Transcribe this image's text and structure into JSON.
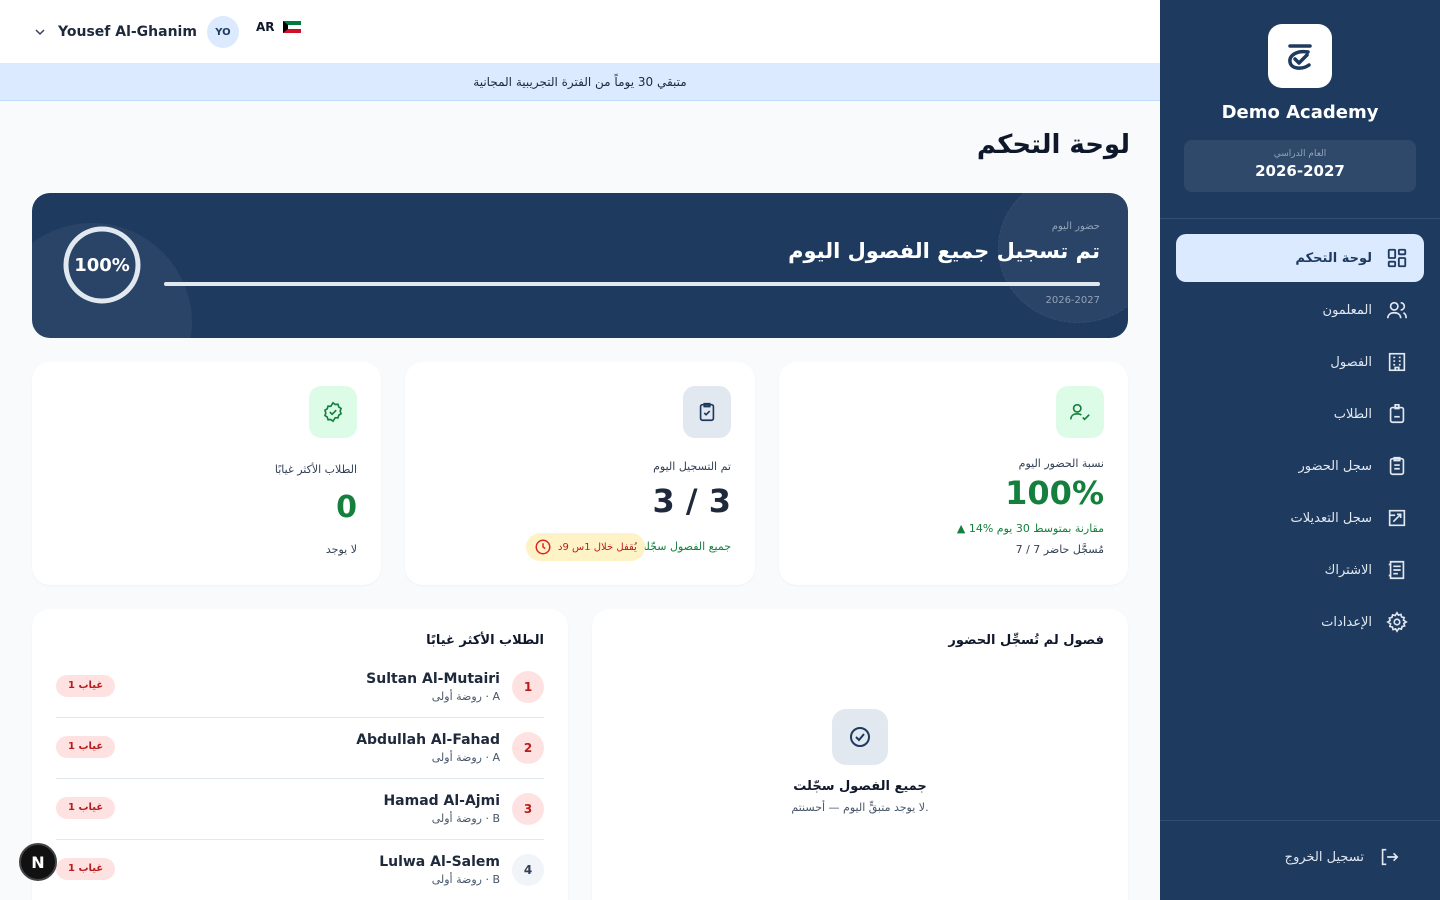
{
  "sidebar": {
    "org_name": "Demo Academy",
    "year_label": "العام الدراسي",
    "year_value": "2026-2027",
    "nav": [
      {
        "label": "لوحة التحكم",
        "icon": "dashboard-icon",
        "active": true
      },
      {
        "label": "المعلمون",
        "icon": "users-icon"
      },
      {
        "label": "الفصول",
        "icon": "building-icon"
      },
      {
        "label": "الطلاب",
        "icon": "badge-icon"
      },
      {
        "label": "سجل الحضور",
        "icon": "clipboard-icon"
      },
      {
        "label": "سجل التعديلات",
        "icon": "history-icon"
      },
      {
        "label": "الاشتراك",
        "icon": "receipt-icon"
      },
      {
        "label": "الإعدادات",
        "icon": "gear-icon"
      }
    ],
    "logout": "تسجيل الخروج"
  },
  "topbar": {
    "user_name": "Yousef Al-Ghanim",
    "avatar_initials": "YO",
    "language": "AR"
  },
  "trial_banner": "متبقي 30 يوماً من الفترة التجريبية المجانية",
  "page_title": "لوحة التحكم",
  "hero": {
    "label": "حضور اليوم",
    "heading": "تم تسجيل جميع الفصول اليوم",
    "percent": "100%",
    "progress": 1.0,
    "year": "2026-2027"
  },
  "stats": {
    "attendance": {
      "label": "نسبة الحضور اليوم",
      "value": "100%",
      "trend": "▲ 14% مقارنة بمتوسط 30 يوم",
      "present": "7 / 7 مُسجَّل حاضر"
    },
    "recorded": {
      "label": "تم التسجيل اليوم",
      "value": "3 / 3",
      "sub": "جميع الفصول سجّلت",
      "lock": "يُقفل خلال 1س 9د"
    },
    "absent": {
      "label": "الطلاب الأكثر غيابًا",
      "value": "0",
      "sub": "لا يوجد"
    }
  },
  "top_absent": {
    "title": "الطلاب الأكثر غيابًا",
    "rows": [
      {
        "rank": "1",
        "name": "Sultan Al-Mutairi",
        "class": "روضة أولى · A",
        "badge": "1 غياب"
      },
      {
        "rank": "2",
        "name": "Abdullah Al-Fahad",
        "class": "روضة أولى · A",
        "badge": "1 غياب"
      },
      {
        "rank": "3",
        "name": "Hamad Al-Ajmi",
        "class": "روضة أولى · B",
        "badge": "1 غياب"
      },
      {
        "rank": "4",
        "name": "Lulwa Al-Salem",
        "class": "روضة أولى · B",
        "badge": "1 غياب"
      }
    ]
  },
  "unrecorded": {
    "title": "فصول لم تُسجِّل الحضور",
    "empty_title": "جميع الفصول سجّلت",
    "empty_sub": "لا يوجد متبقٍّ اليوم — أحسنتم."
  },
  "dev_badge": "N",
  "colors": {
    "sidebar": "#1e3a5f",
    "accent_green": "#15803d",
    "badge_red": "#fee2e2"
  }
}
